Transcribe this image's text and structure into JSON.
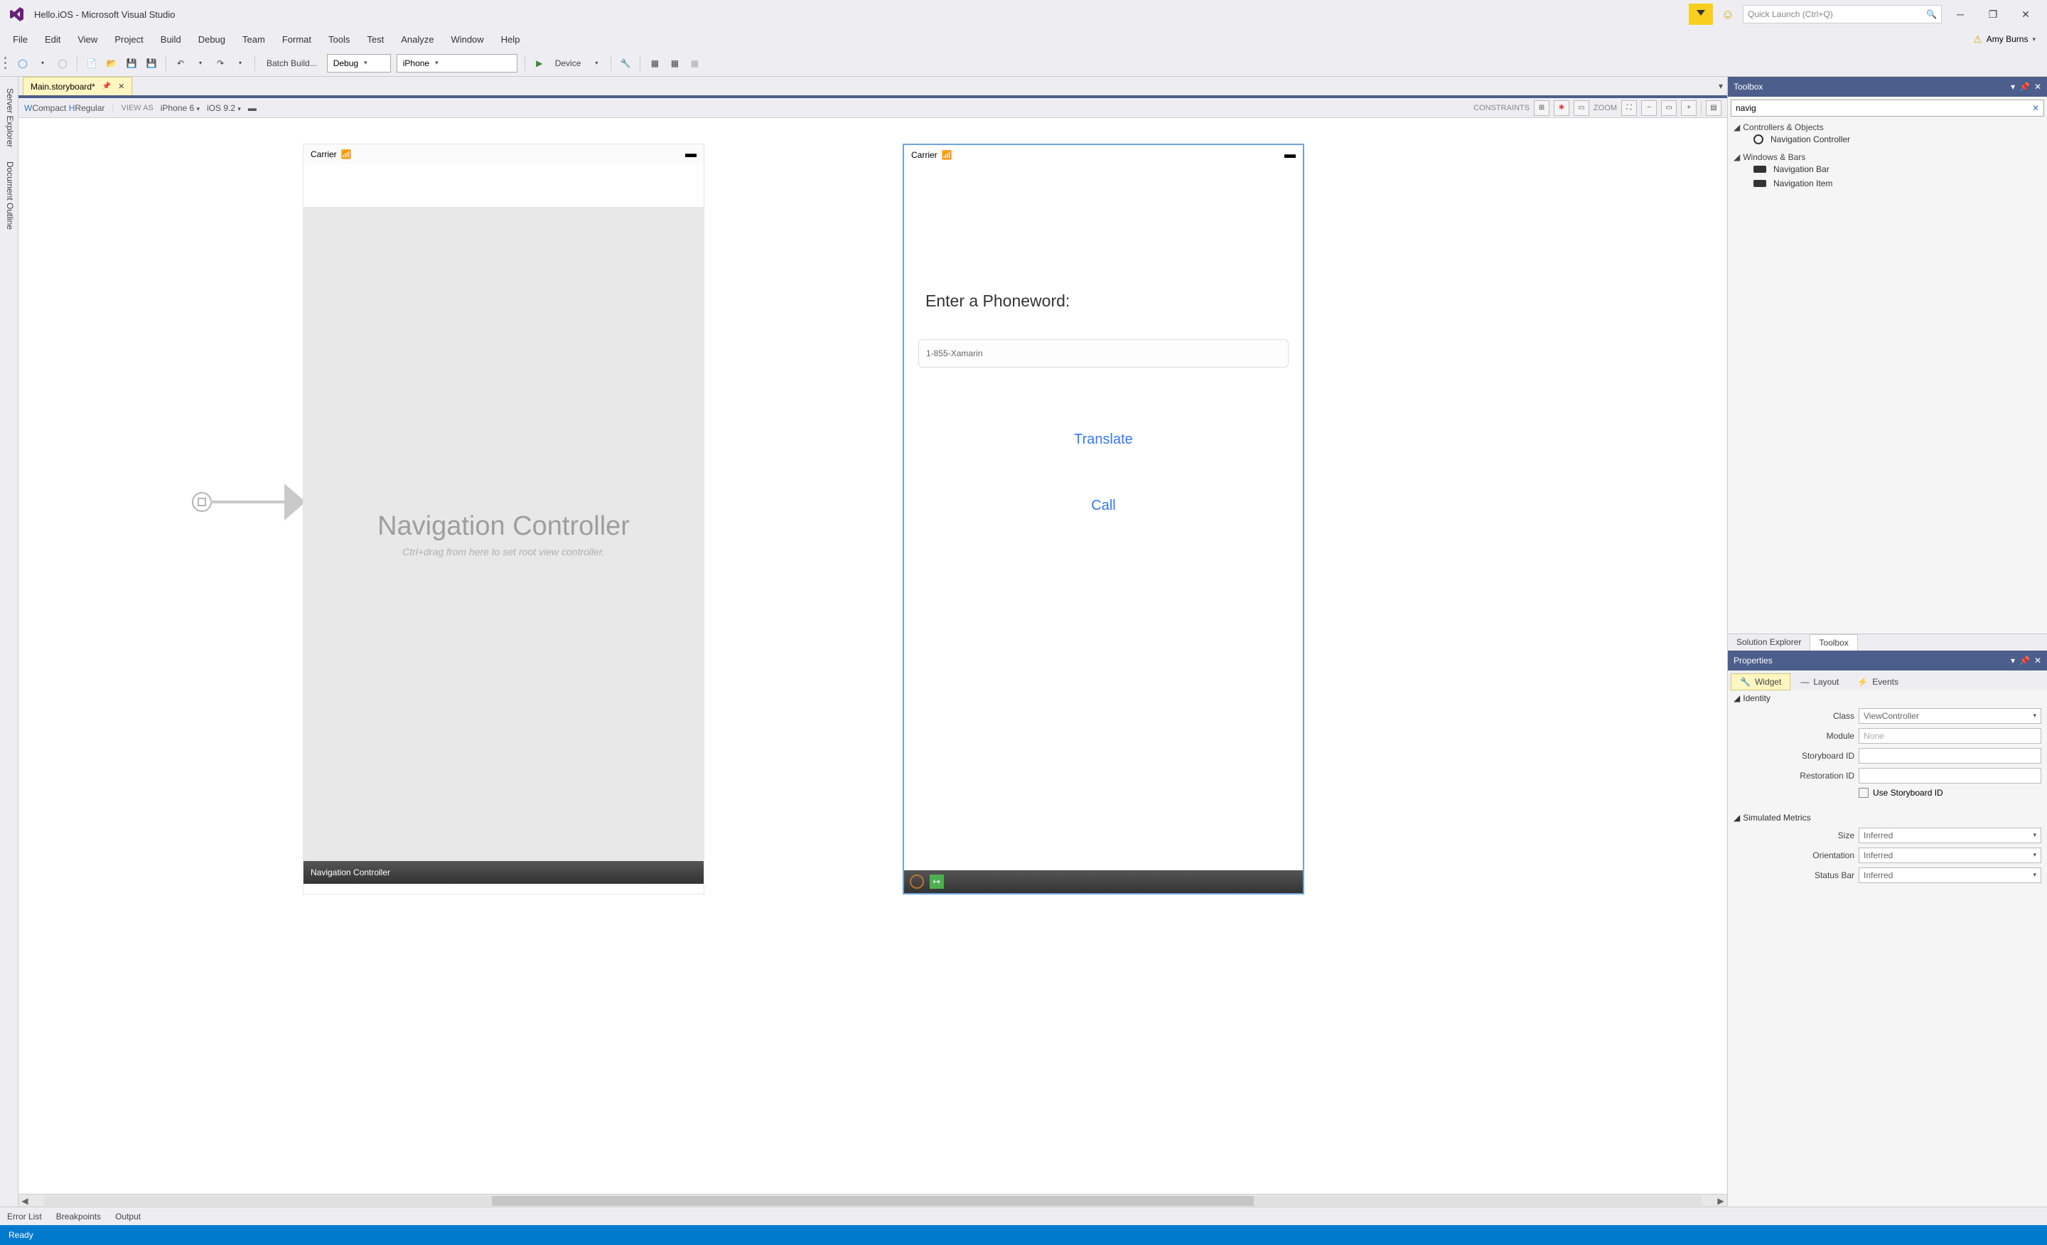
{
  "title": "Hello.iOS - Microsoft Visual Studio",
  "quick_launch_placeholder": "Quick Launch (Ctrl+Q)",
  "user_name": "Amy Burns",
  "menu": [
    "File",
    "Edit",
    "View",
    "Project",
    "Build",
    "Debug",
    "Team",
    "Format",
    "Tools",
    "Test",
    "Analyze",
    "Window",
    "Help"
  ],
  "toolbar": {
    "batch_build": "Batch Build...",
    "config": "Debug",
    "platform": "iPhone",
    "device": "Device"
  },
  "left_rail": [
    "Server Explorer",
    "Document Outline"
  ],
  "tab": {
    "name": "Main.storyboard*",
    "pinned": true
  },
  "designer_bar": {
    "size_class": "WCompact HRegular",
    "view_as": "VIEW AS",
    "device": "iPhone 6",
    "ios": "iOS 9.2",
    "constraints": "CONSTRAINTS",
    "zoom": "ZOOM"
  },
  "nav_phone": {
    "carrier": "Carrier",
    "title": "Navigation Controller",
    "hint": "Ctrl+drag from here to set root view controller.",
    "footer": "Navigation Controller"
  },
  "main_phone": {
    "carrier": "Carrier",
    "label": "Enter a Phoneword:",
    "field_value": "1-855-Xamarin",
    "translate": "Translate",
    "call": "Call"
  },
  "toolbox": {
    "title": "Toolbox",
    "search_value": "navig",
    "groups": [
      {
        "name": "Controllers & Objects",
        "items": [
          {
            "label": "Navigation Controller",
            "shape": "circ"
          }
        ]
      },
      {
        "name": "Windows & Bars",
        "items": [
          {
            "label": "Navigation Bar",
            "shape": "bar"
          },
          {
            "label": "Navigation Item",
            "shape": "bar"
          }
        ]
      }
    ],
    "side_tabs": [
      "Solution Explorer",
      "Toolbox"
    ]
  },
  "properties": {
    "title": "Properties",
    "tabs": [
      {
        "label": "Widget",
        "icon": "🔧"
      },
      {
        "label": "Layout",
        "icon": "—"
      },
      {
        "label": "Events",
        "icon": "⚡"
      }
    ],
    "identity_hdr": "Identity",
    "identity": {
      "class_label": "Class",
      "class_value": "ViewController",
      "module_label": "Module",
      "module_placeholder": "None",
      "storyboard_id_label": "Storyboard ID",
      "restoration_id_label": "Restoration ID",
      "use_storyboard_id": "Use Storyboard ID"
    },
    "sim_hdr": "Simulated Metrics",
    "sim": {
      "size_label": "Size",
      "size_value": "Inferred",
      "orientation_label": "Orientation",
      "orientation_value": "Inferred",
      "statusbar_label": "Status Bar",
      "statusbar_value": "Inferred"
    }
  },
  "bottom_tabs": [
    "Error List",
    "Breakpoints",
    "Output"
  ],
  "status": "Ready"
}
